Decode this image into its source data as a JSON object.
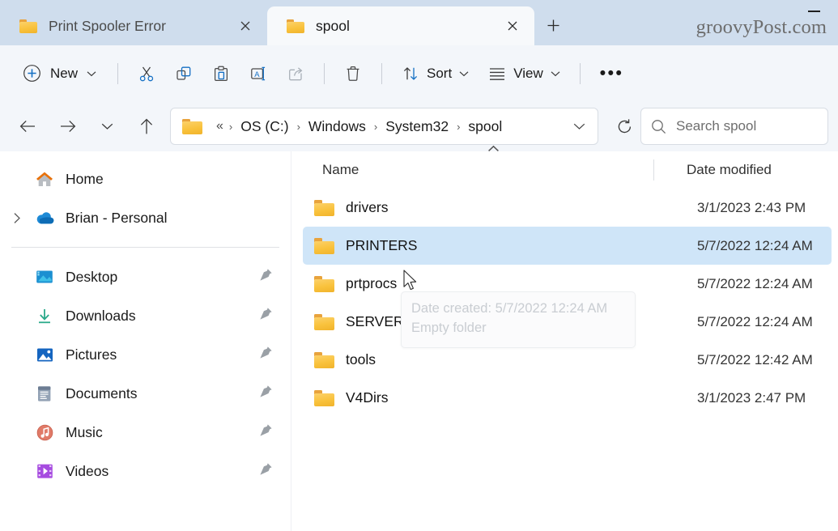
{
  "window": {
    "minimize_label": "minimize",
    "watermark": "groovyPost.com"
  },
  "tabs": [
    {
      "label": "Print Spooler Error",
      "icon": "folder-icon",
      "active": false,
      "close_label": "✕"
    },
    {
      "label": "spool",
      "icon": "folder-icon",
      "active": true,
      "close_label": "✕"
    }
  ],
  "newtab": {
    "label": "+"
  },
  "toolbar": {
    "new_label": "New",
    "new_icon": "plus-circle-icon",
    "cut_icon": "scissors-icon",
    "copy_icon": "copy-icon",
    "paste_icon": "paste-icon",
    "rename_icon": "rename-icon",
    "share_icon": "share-icon",
    "delete_icon": "trash-icon",
    "sort_label": "Sort",
    "sort_icon": "sort-arrows-icon",
    "view_label": "View",
    "view_icon": "lines-icon",
    "more_label": "•••"
  },
  "address": {
    "back_icon": "arrow-left-icon",
    "forward_icon": "arrow-right-icon",
    "recent_icon": "chevron-down-icon",
    "up_icon": "arrow-up-icon",
    "folder_icon": "folder-icon",
    "overflow": "«",
    "crumbs": [
      "OS (C:)",
      "Windows",
      "System32",
      "spool"
    ],
    "separator": "›",
    "dropdown_icon": "chevron-down-icon",
    "refresh_icon": "refresh-icon"
  },
  "search": {
    "placeholder": "Search spool",
    "icon": "search-icon"
  },
  "sidebar": {
    "items": [
      {
        "label": "Home",
        "icon": "home-icon",
        "expandable": false,
        "pinned": false
      },
      {
        "label": "Brian - Personal",
        "icon": "onedrive-icon",
        "expandable": true,
        "pinned": false
      },
      {
        "divider": true
      },
      {
        "label": "Desktop",
        "icon": "desktop-icon",
        "expandable": false,
        "pinned": true
      },
      {
        "label": "Downloads",
        "icon": "downloads-icon",
        "expandable": false,
        "pinned": true
      },
      {
        "label": "Pictures",
        "icon": "pictures-icon",
        "expandable": false,
        "pinned": true
      },
      {
        "label": "Documents",
        "icon": "documents-icon",
        "expandable": false,
        "pinned": true
      },
      {
        "label": "Music",
        "icon": "music-icon",
        "expandable": false,
        "pinned": true
      },
      {
        "label": "Videos",
        "icon": "videos-icon",
        "expandable": false,
        "pinned": true
      }
    ]
  },
  "filelist": {
    "columns": {
      "name": "Name",
      "date_modified": "Date modified"
    },
    "sort_indicator": "ascending",
    "rows": [
      {
        "name": "drivers",
        "date": "3/1/2023 2:43 PM",
        "icon": "folder-icon",
        "selected": false
      },
      {
        "name": "PRINTERS",
        "date": "5/7/2022 12:24 AM",
        "icon": "folder-icon",
        "selected": true
      },
      {
        "name": "prtprocs",
        "date": "5/7/2022 12:24 AM",
        "icon": "folder-icon",
        "selected": false
      },
      {
        "name": "SERVERS",
        "date": "5/7/2022 12:24 AM",
        "icon": "folder-icon",
        "selected": false
      },
      {
        "name": "tools",
        "date": "5/7/2022 12:42 AM",
        "icon": "folder-icon",
        "selected": false
      },
      {
        "name": "V4Dirs",
        "date": "3/1/2023 2:47 PM",
        "icon": "folder-icon",
        "selected": false
      }
    ]
  },
  "tooltip": {
    "line1": "Date created: 5/7/2022 12:24 AM",
    "line2": "Empty folder"
  },
  "colors": {
    "titlebar": "#cfdded",
    "toolbar": "#f3f6fa",
    "active_tab": "#f7f9fb",
    "selection": "#cfe5f8",
    "accent": "#0f6cbd",
    "folder": "#f9c23c"
  }
}
